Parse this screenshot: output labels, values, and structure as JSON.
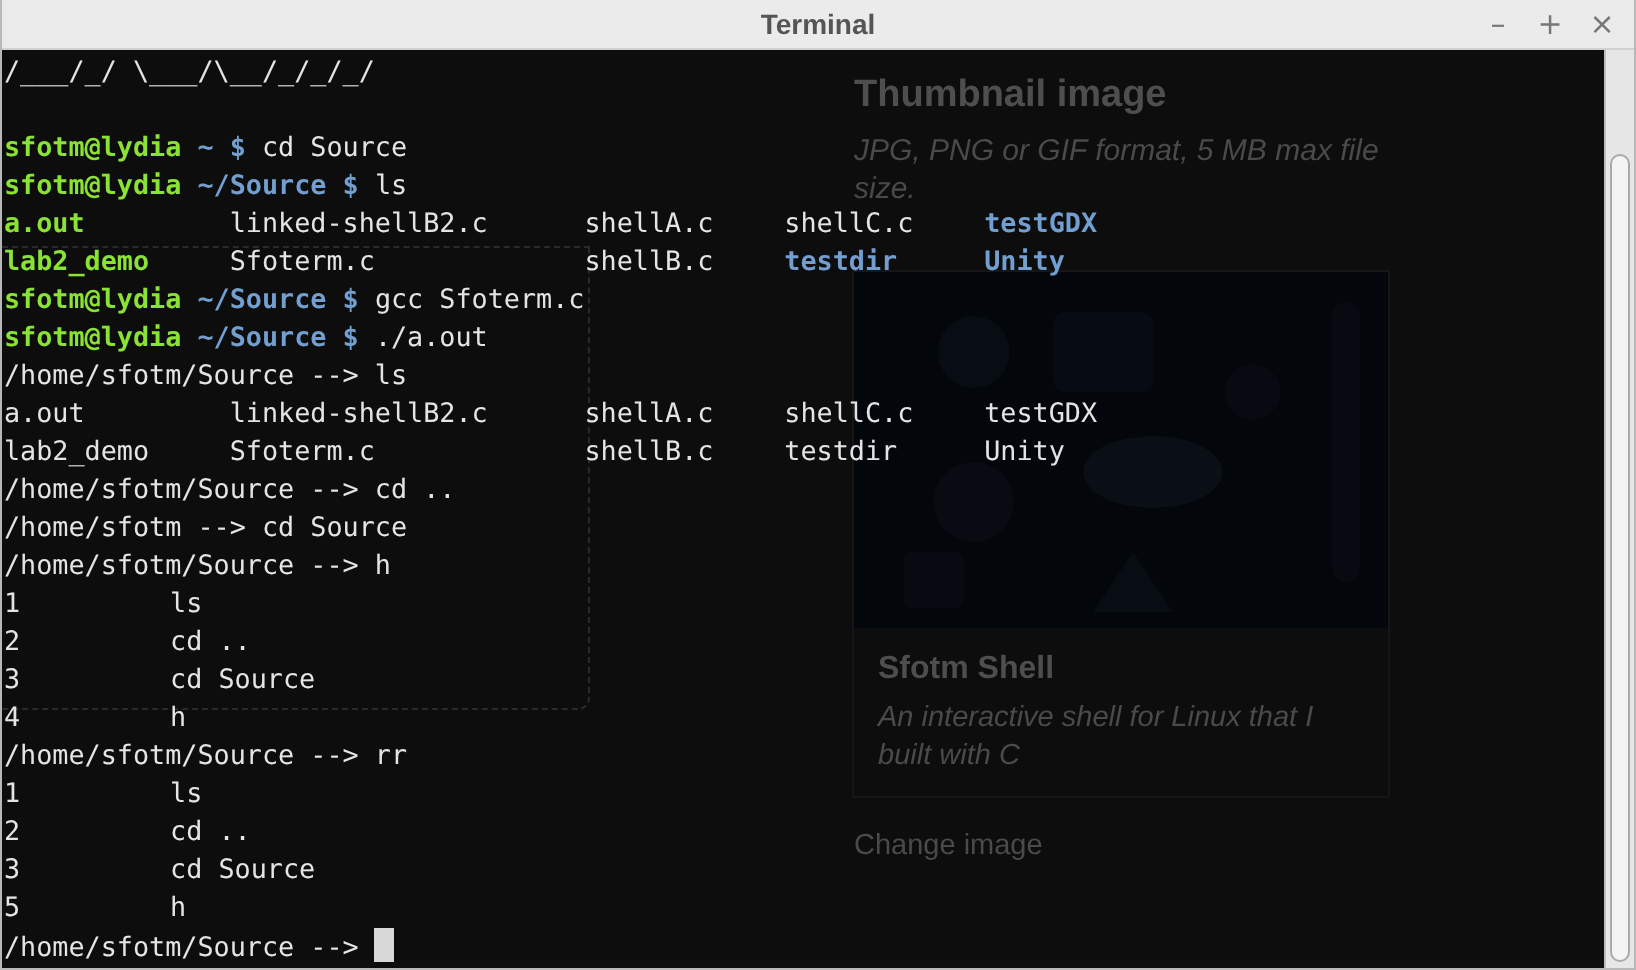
{
  "window": {
    "title": "Terminal",
    "controls": [
      "–",
      "+",
      "×"
    ]
  },
  "background_page": {
    "heading": "Thumbnail image",
    "hint": "JPG, PNG or GIF format, 5 MB max file size.",
    "card": {
      "kind": "picture",
      "title": "Sfotm Shell",
      "description": "An interactive shell for Linux that I built with C"
    },
    "link": "Change image"
  },
  "terminal": {
    "lines": [
      {
        "kind": "text",
        "text": "/___/_/ \\___/\\__/_/_/_/"
      },
      {
        "kind": "blank"
      },
      {
        "kind": "prompt",
        "user": "sfotm@lydia",
        "path": "~ $",
        "command": "cd Source"
      },
      {
        "kind": "prompt",
        "user": "sfotm@lydia",
        "path": "~/Source $",
        "command": "ls"
      },
      {
        "kind": "columns",
        "cells": [
          {
            "text": "a.out",
            "kind": "exec"
          },
          {
            "text": "linked-shellB2.c",
            "kind": "file"
          },
          {
            "text": "shellA.c",
            "kind": "file"
          },
          {
            "text": "shellC.c",
            "kind": "file"
          },
          {
            "text": "testGDX",
            "kind": "dir"
          }
        ]
      },
      {
        "kind": "columns",
        "cells": [
          {
            "text": "lab2_demo",
            "kind": "exec"
          },
          {
            "text": "Sfoterm.c",
            "kind": "file"
          },
          {
            "text": "shellB.c",
            "kind": "file"
          },
          {
            "text": "testdir",
            "kind": "dir"
          },
          {
            "text": "Unity",
            "kind": "dir"
          }
        ]
      },
      {
        "kind": "prompt",
        "user": "sfotm@lydia",
        "path": "~/Source $",
        "command": "gcc Sfoterm.c"
      },
      {
        "kind": "prompt",
        "user": "sfotm@lydia",
        "path": "~/Source $",
        "command": "./a.out"
      },
      {
        "kind": "text",
        "text": "/home/sfotm/Source --> ls"
      },
      {
        "kind": "columns",
        "cells": [
          {
            "text": "a.out",
            "kind": "file"
          },
          {
            "text": "linked-shellB2.c",
            "kind": "file"
          },
          {
            "text": "shellA.c",
            "kind": "file"
          },
          {
            "text": "shellC.c",
            "kind": "file"
          },
          {
            "text": "testGDX",
            "kind": "file"
          }
        ]
      },
      {
        "kind": "columns",
        "cells": [
          {
            "text": "lab2_demo",
            "kind": "file"
          },
          {
            "text": "Sfoterm.c",
            "kind": "file"
          },
          {
            "text": "shellB.c",
            "kind": "file"
          },
          {
            "text": "testdir",
            "kind": "file"
          },
          {
            "text": "Unity",
            "kind": "file"
          }
        ]
      },
      {
        "kind": "text",
        "text": "/home/sfotm/Source --> cd .."
      },
      {
        "kind": "text",
        "text": "/home/sfotm --> cd Source"
      },
      {
        "kind": "text",
        "text": "/home/sfotm/Source --> h"
      },
      {
        "kind": "history",
        "number": "1",
        "command": "ls"
      },
      {
        "kind": "history",
        "number": "2",
        "command": "cd .."
      },
      {
        "kind": "history",
        "number": "3",
        "command": "cd Source"
      },
      {
        "kind": "history",
        "number": "4",
        "command": "h"
      },
      {
        "kind": "text",
        "text": "/home/sfotm/Source --> rr"
      },
      {
        "kind": "history",
        "number": "1",
        "command": "ls"
      },
      {
        "kind": "history",
        "number": "2",
        "command": "cd .."
      },
      {
        "kind": "history",
        "number": "3",
        "command": "cd Source"
      },
      {
        "kind": "history",
        "number": "5",
        "command": "h"
      },
      {
        "kind": "text",
        "text": "/home/sfotm/Source -->",
        "cursor": true
      }
    ]
  }
}
